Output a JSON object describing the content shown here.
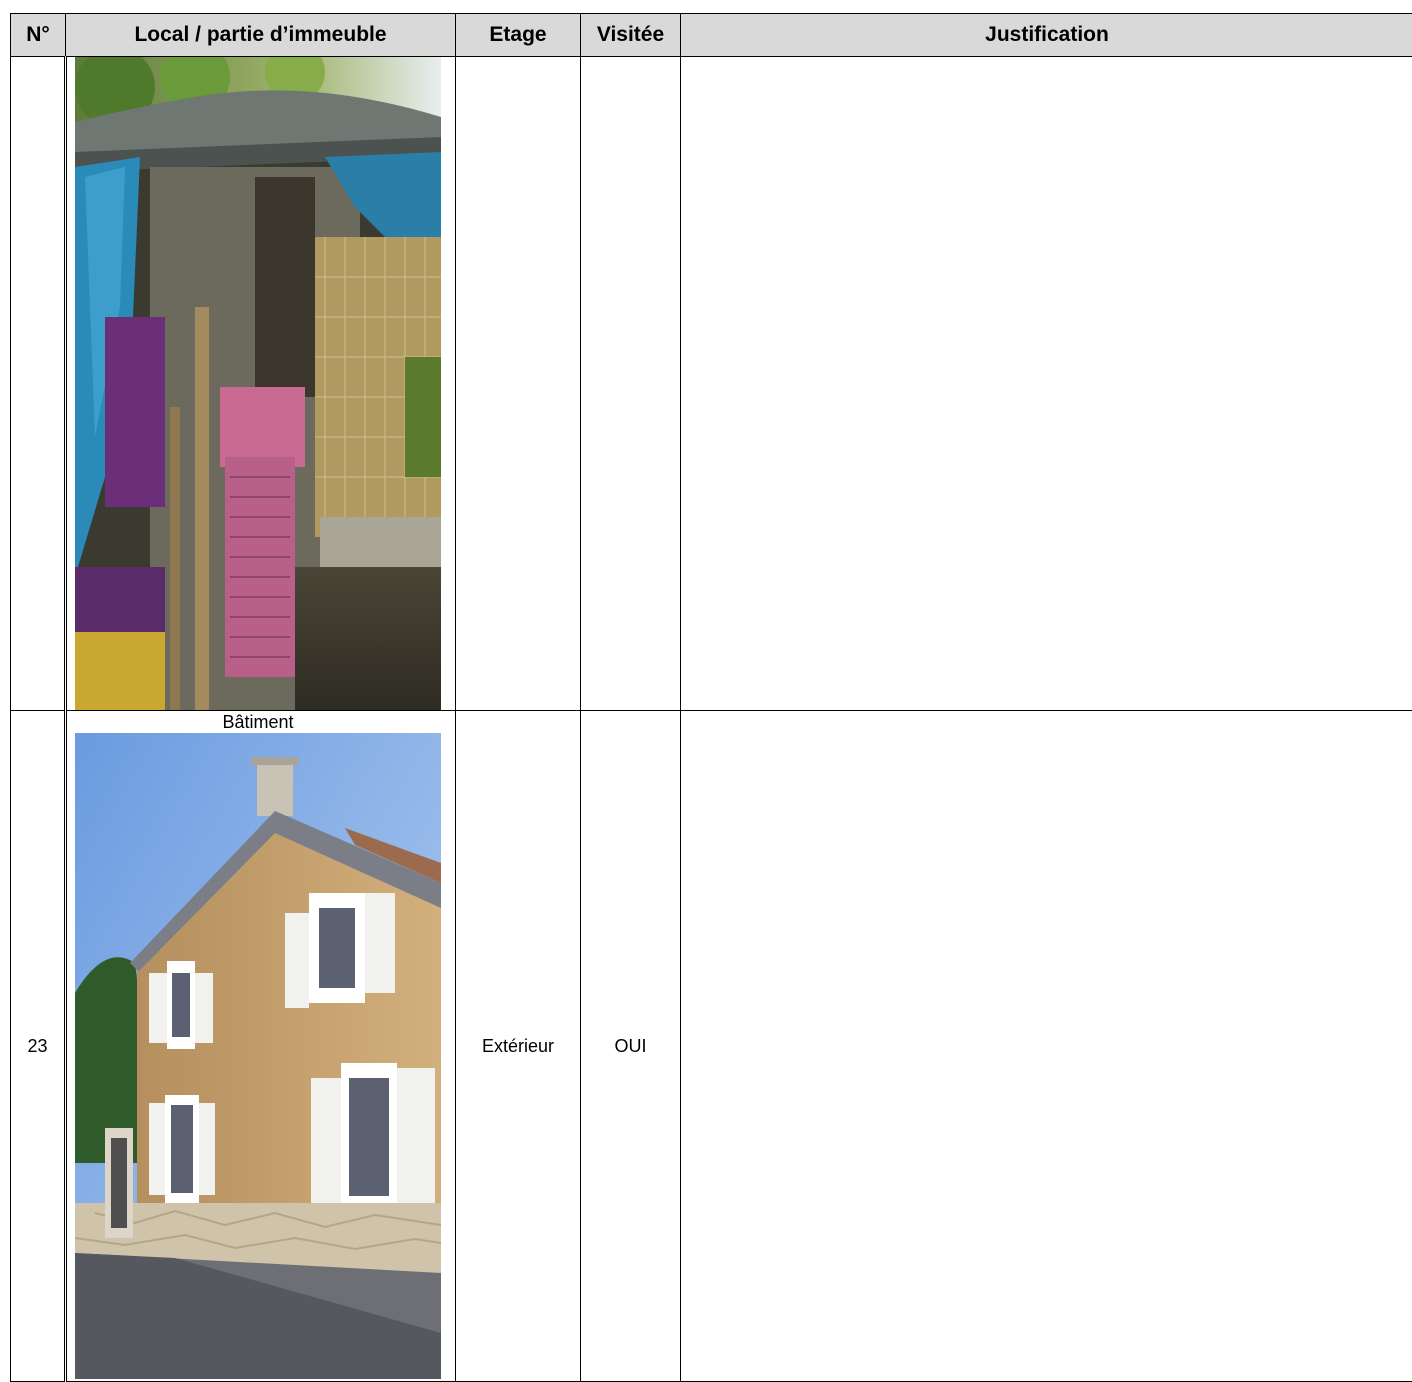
{
  "table": {
    "headers": {
      "no": "N°",
      "local": "Local / partie d’immeuble",
      "etage": "Etage",
      "visitee": "Visitée",
      "justification": "Justification"
    },
    "rows": [
      {
        "no": "",
        "photo_caption": "",
        "etage": "",
        "visitee": "",
        "justification": ""
      },
      {
        "no": "23",
        "photo_caption": "Bâtiment",
        "etage": "Extérieur",
        "visitee": "OUI",
        "justification": ""
      }
    ]
  },
  "colors": {
    "header_bg": "#d9d9d9",
    "border": "#000000"
  }
}
